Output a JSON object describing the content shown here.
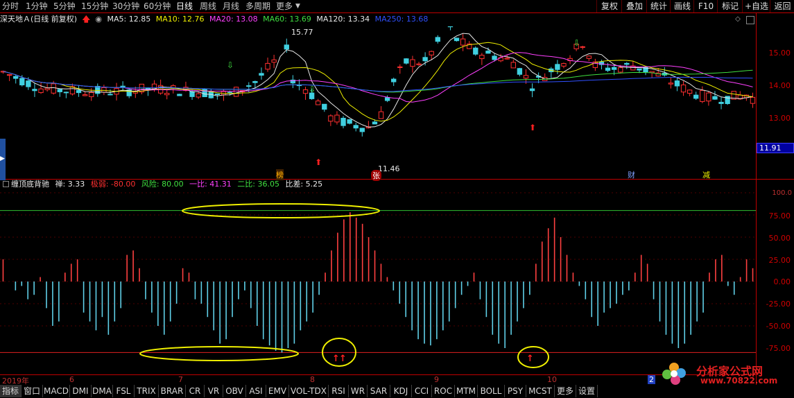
{
  "toolbar": {
    "periods": [
      "分时",
      "1分钟",
      "5分钟",
      "15分钟",
      "30分钟",
      "60分钟",
      "日线",
      "周线",
      "月线",
      "多周期",
      "更多"
    ],
    "active_period": "日线",
    "right_buttons": [
      "复权",
      "叠加",
      "统计",
      "画线",
      "F10",
      "标记",
      "+自选",
      "返回"
    ]
  },
  "ma_bar": {
    "title": "深天地Ａ(日线 前复权)",
    "items": [
      {
        "label": "MA5: 12.85",
        "color": "#e8e8e8"
      },
      {
        "label": "MA10: 12.76",
        "color": "#f0f000"
      },
      {
        "label": "MA20: 13.08",
        "color": "#ff40ff"
      },
      {
        "label": "MA60: 13.69",
        "color": "#40e040"
      },
      {
        "label": "MA120: 13.34",
        "color": "#e8e8e8"
      },
      {
        "label": "MA250: 13.68",
        "color": "#3050ff"
      }
    ]
  },
  "price_axis": {
    "ticks": [
      "15.00",
      "14.00",
      "13.00"
    ],
    "current_price": "11.91"
  },
  "annotations": {
    "high": "15.77",
    "low": "11.46",
    "events": [
      {
        "text": "榜",
        "color": "#ffb000"
      },
      {
        "text": "张",
        "color": "#ffffff"
      },
      {
        "text": "财",
        "color": "#80a0ff"
      },
      {
        "text": "减",
        "color": "#f0f000"
      }
    ]
  },
  "indicator": {
    "name": "缠顶底背驰",
    "items": [
      {
        "label": "禅: 3.33",
        "color": "#e8e8e8"
      },
      {
        "label": "极弱: -80.00",
        "color": "#ff3030"
      },
      {
        "label": "风险: 80.00",
        "color": "#40e040"
      },
      {
        "label": "一比: 41.31",
        "color": "#ff40ff"
      },
      {
        "label": "二比: 36.05",
        "color": "#40e040"
      },
      {
        "label": "比差: 5.25",
        "color": "#e8e8e8"
      }
    ],
    "ticks": [
      "100.0",
      "75.00",
      "50.00",
      "25.00",
      "0.00",
      "-25.00",
      "-50.00",
      "-75.00"
    ],
    "upper_level": 80,
    "lower_level": -80
  },
  "date_axis": {
    "labels": [
      "2019年",
      "6",
      "7",
      "8",
      "9",
      "10",
      "2"
    ]
  },
  "bottom_tabs": [
    "指标",
    "窗口",
    "MACD",
    "DMI",
    "DMA",
    "FSL",
    "TRIX",
    "BRAR",
    "CR",
    "VR",
    "OBV",
    "ASI",
    "EMV",
    "VOL-TDX",
    "RSI",
    "WR",
    "SAR",
    "KDJ",
    "CCI",
    "ROC",
    "MTM",
    "BOLL",
    "PSY",
    "MCST",
    "更多",
    "设置"
  ],
  "watermark": {
    "title": "分析家公式网",
    "url": "www.70822.com"
  },
  "colors": {
    "up": "#ff3030",
    "down": "#40d0e0",
    "axis": "#c00000",
    "ellipse": "#f0f000"
  }
}
